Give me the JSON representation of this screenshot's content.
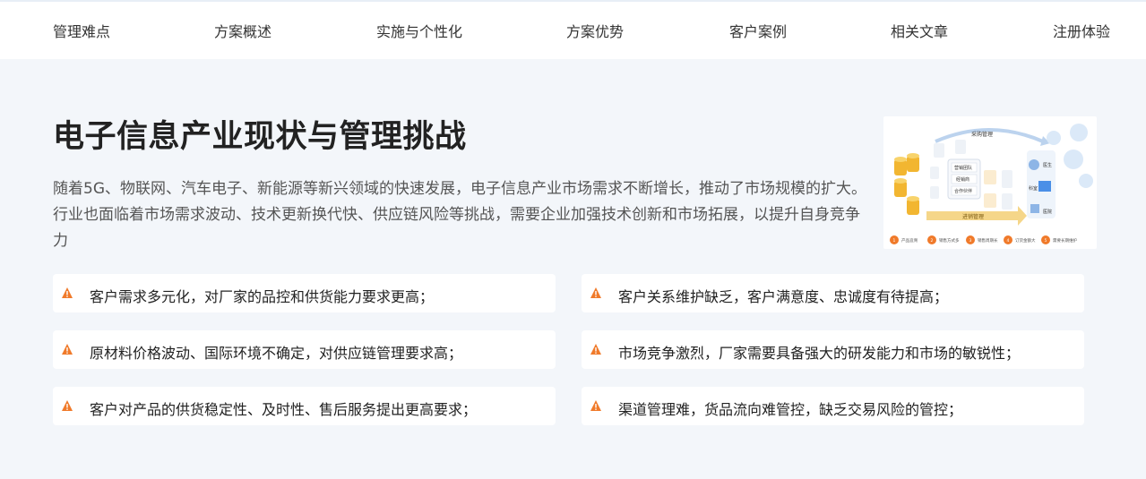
{
  "nav": {
    "items": [
      "管理难点",
      "方案概述",
      "实施与个性化",
      "方案优势",
      "客户案例",
      "相关文章",
      "注册体验"
    ]
  },
  "section": {
    "title": "电子信息产业现状与管理挑战",
    "description": "随着5G、物联网、汽车电子、新能源等新兴领域的快速发展，电子信息产业市场需求不断增长，推动了市场规模的扩大。行业也面临着市场需求波动、技术更新换代快、供应链风险等挑战，需要企业加强技术创新和市场拓展，以提升自身竞争力"
  },
  "illustration": {
    "labels": {
      "top": "采购管理",
      "bottom": "进销管理",
      "team": "营销团队",
      "distributor": "经销商",
      "partner": "合作伙伴",
      "doctor": "医生",
      "clinic": "科室",
      "hospital": "医院"
    },
    "steps": [
      "产品追溯",
      "销售方式多",
      "销售周期长",
      "订货金额大",
      "需要长期维护"
    ]
  },
  "challenges": [
    "客户需求多元化，对厂家的品控和供货能力要求更高；",
    "客户关系维护缺乏，客户满意度、忠诚度有待提高；",
    "原材料价格波动、国际环境不确定，对供应链管理要求高；",
    "市场竞争激烈，厂家需要具备强大的研发能力和市场的敏锐性；",
    "客户对产品的供货稳定性、及时性、售后服务提出更高要求；",
    "渠道管理难，货品流向难管控，缺乏交易风险的管控；"
  ],
  "colors": {
    "warning_icon": "#f07a2a",
    "accent_blue": "#4a8fe7",
    "gold": "#f2b631",
    "background": "#f3f6fa"
  },
  "icons": {
    "warning": "warning-icon"
  }
}
